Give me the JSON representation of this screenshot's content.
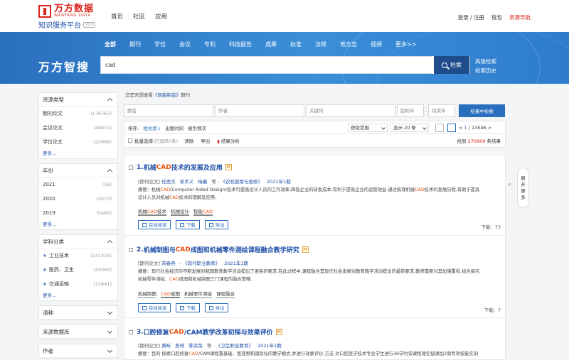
{
  "header": {
    "logo_cn": "万方数据",
    "logo_en": "WANFANG DATA",
    "subtitle": "知识服务平台",
    "version": "V2.0",
    "nav": [
      "首页",
      "社区",
      "应用"
    ],
    "links": {
      "login": "登录 / 注册",
      "wallet": "钱包",
      "resource_nav": "资源导航"
    }
  },
  "search": {
    "categories": [
      "全部",
      "期刊",
      "学位",
      "会议",
      "专利",
      "科技报告",
      "成果",
      "标准",
      "法规",
      "地方志",
      "视频",
      "更多>>"
    ],
    "brand": "万方智搜",
    "query": "cad",
    "button": "检索",
    "advanced": "高级检索",
    "history": "检索历史"
  },
  "sidebar": {
    "resource_type": {
      "title": "资源类型",
      "items": [
        {
          "label": "期刊论文",
          "count": "(176767)"
        },
        {
          "label": "会议论文",
          "count": "(48674)"
        },
        {
          "label": "学位论文",
          "count": "(22966)"
        }
      ],
      "more": "更多..."
    },
    "year": {
      "title": "年份",
      "items": [
        {
          "label": "2021",
          "count": "(36)"
        },
        {
          "label": "2020",
          "count": "(2573)"
        },
        {
          "label": "2019",
          "count": "(5445)"
        }
      ],
      "more": "更多..."
    },
    "subject": {
      "title": "学科分类",
      "items": [
        {
          "label": "工业技术",
          "count": "(141426)"
        },
        {
          "label": "医药、卫生",
          "count": "(33063)"
        },
        {
          "label": "交通运输",
          "count": "(12841)"
        }
      ],
      "more": "更多..."
    },
    "collapsed": [
      "语种",
      "来源数据库",
      "作者"
    ]
  },
  "main": {
    "hint_prefix": "您是否想查看",
    "hint_link": "《智能制造》",
    "hint_suffix": "期刊",
    "filters": {
      "title": "题名",
      "author": "作者",
      "keyword": "关键词",
      "year_from": "起始年",
      "year_to": "结束年",
      "button": "结果中检索"
    },
    "toolbar": {
      "sort_label": "排序:",
      "sorts": [
        "相关度",
        "出版时间",
        "被引频次"
      ],
      "range": "获取范围",
      "page_size": "显示 20 条",
      "pager_prev": "<",
      "pager_page": "1",
      "pager_total": "/ 13546",
      "pager_next": ">"
    },
    "bulk": {
      "select": "批量选择",
      "selected": "(已选择0条)",
      "clear": "清除",
      "export": "导出",
      "analysis": "结果分析",
      "found_prefix": "找到",
      "found_num": "270909",
      "found_suffix": "条结果"
    }
  },
  "results": [
    {
      "num": "1.",
      "title_pre": "机械",
      "title_hl": "CAD",
      "title_post": "技术的发展及应用",
      "type": "[期刊论文]",
      "authors": [
        "任思杰",
        "郭术义",
        "杨襄"
      ],
      "etal": "等",
      "journal": "《农机使用与维修》",
      "date": "2021年1期",
      "abstract_1a": "摘要：机械",
      "abstract_1hl": "CAD",
      "abstract_1b": "(Computer Aided Design)技术可提高设计人员的工作效率,降低企业的研发成本,有利于提高企业的运营效益.通过梳理机械",
      "abstract_1hl2": "CAD",
      "abstract_1c": "技术的发展历程,有助于提高",
      "abstract_2a": "设计人员对机械",
      "abstract_2hl": "CAD",
      "abstract_2b": "技术的理解及应用.",
      "keywords": [
        {
          "pre": "机械",
          "hl": "CAD",
          "post": "技术"
        },
        {
          "pre": "机械设计",
          "hl": "",
          "post": ""
        },
        {
          "pre": "智能",
          "hl": "CAD",
          "post": ""
        }
      ],
      "downloads": "下载：73"
    },
    {
      "num": "2.",
      "title_pre": "机械制图与",
      "title_hl": "CAD",
      "title_post": "成图和机械零件测绘课程融合教学研究",
      "type": "[期刊论文]",
      "authors": [
        "芮春燕"
      ],
      "etal": "",
      "journal": "《现代职业教育》",
      "date": "2021年1期",
      "abstract_1a": "摘要：现代社会经济的不断发展对我国教育教学活动提出了更高的要求,在此过程中,课程融合是现代社会发展对教育教学活动提出的最新要求,教师需要对其加强重视,综合探究",
      "abstract_1hl": "",
      "abstract_1b": "",
      "abstract_1hl2": "",
      "abstract_1c": "",
      "abstract_2a": "机械零件测绘、",
      "abstract_2hl": "CAD",
      "abstract_2b": "成图和机械制图三门课程的融合策略.",
      "keywords": [
        {
          "pre": "机械制图",
          "hl": "",
          "post": ""
        },
        {
          "pre": "",
          "hl": "CAD",
          "post": "成图"
        },
        {
          "pre": "机械零件测绘",
          "hl": "",
          "post": ""
        },
        {
          "pre": "课程融合",
          "hl": "",
          "post": ""
        }
      ],
      "downloads": "下载：7"
    },
    {
      "num": "3.",
      "title_pre": "口腔修复",
      "title_hl": "CAD",
      "title_post": "/CAM教学改革初探与效果评价",
      "type": "[期刊论文]",
      "authors": [
        "黄昕",
        "詹琦",
        "陈荣荣"
      ],
      "etal": "等",
      "journal": "《卫生职业教育》",
      "date": "2021年1期",
      "abstract_1a": "摘要：目的 探索口腔修复",
      "abstract_1hl": "CAD",
      "abstract_1b": "/CAM课程重基础、宽视野和国际化的教学模式,并进行效果评价.方法 对口腔医学技术专业学生进行36学时该课程理论授课加2周专项技能实训",
      "abstract_1hl2": "",
      "abstract_1c": "",
      "abstract_2a": "",
      "abstract_2hl": "",
      "abstract_2b": "",
      "keywords": [],
      "downloads": ""
    }
  ],
  "result_buttons": {
    "read": "在线阅读",
    "download": "下载",
    "export": "导出"
  },
  "expand_tab": [
    "展",
    "开",
    "更",
    "多"
  ],
  "colors": {
    "brand_blue": "#2a6fbe",
    "brand_red": "#d9231b",
    "highlight": "#e8500e"
  }
}
